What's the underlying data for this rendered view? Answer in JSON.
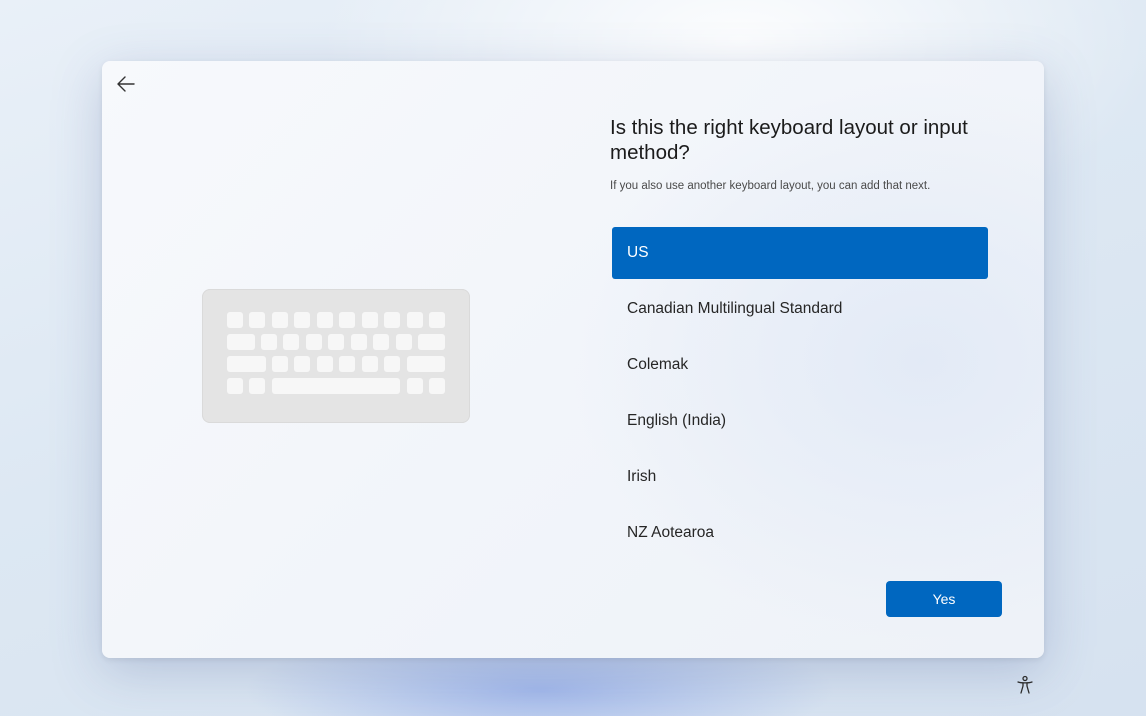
{
  "header": {
    "back_icon": "arrow-left-icon"
  },
  "illustration": {
    "icon": "keyboard-icon"
  },
  "content": {
    "title": "Is this the right keyboard layout or input method?",
    "subtitle": "If you also use another keyboard layout, you can add that next."
  },
  "layouts": {
    "selected": "US",
    "items": [
      {
        "label": "US"
      },
      {
        "label": "Canadian Multilingual Standard"
      },
      {
        "label": "Colemak"
      },
      {
        "label": "English (India)"
      },
      {
        "label": "Irish"
      },
      {
        "label": "NZ Aotearoa"
      }
    ]
  },
  "actions": {
    "yes_label": "Yes"
  },
  "footer": {
    "accessibility_icon": "accessibility-icon"
  },
  "colors": {
    "accent": "#0067c0",
    "keyboard_base": "#e4e4e4",
    "keyboard_keys": "#f7f7f7"
  }
}
